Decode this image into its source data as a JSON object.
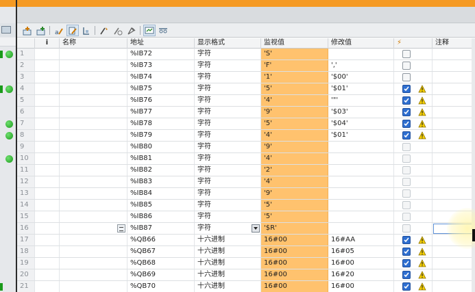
{
  "columns": {
    "num": "",
    "info": "i",
    "name": "名称",
    "address": "地址",
    "format": "显示格式",
    "monitor": "监视值",
    "modify": "修改值",
    "trigger": "⚡",
    "comment": "注释"
  },
  "rows": [
    {
      "num": "1",
      "address": "%IB72",
      "format": "字符",
      "monitor": "'S'",
      "modify": "",
      "checked": false,
      "warn": false,
      "status": "dot-mark"
    },
    {
      "num": "2",
      "address": "%IB73",
      "format": "字符",
      "monitor": "'F'",
      "modify": "','",
      "checked": false,
      "warn": false,
      "status": ""
    },
    {
      "num": "3",
      "address": "%IB74",
      "format": "字符",
      "monitor": "'1'",
      "modify": "'$00'",
      "checked": false,
      "warn": false,
      "status": ""
    },
    {
      "num": "4",
      "address": "%IB75",
      "format": "字符",
      "monitor": "'5'",
      "modify": "'$01'",
      "checked": true,
      "warn": true,
      "status": "dot-mark"
    },
    {
      "num": "5",
      "address": "%IB76",
      "format": "字符",
      "monitor": "'4'",
      "modify": "'\"'",
      "checked": true,
      "warn": true,
      "status": ""
    },
    {
      "num": "6",
      "address": "%IB77",
      "format": "字符",
      "monitor": "'9'",
      "modify": "'$03'",
      "checked": true,
      "warn": true,
      "status": ""
    },
    {
      "num": "7",
      "address": "%IB78",
      "format": "字符",
      "monitor": "'5'",
      "modify": "'$04'",
      "checked": true,
      "warn": true,
      "status": "dot"
    },
    {
      "num": "8",
      "address": "%IB79",
      "format": "字符",
      "monitor": "'4'",
      "modify": "'$01'",
      "checked": true,
      "warn": true,
      "status": "dot"
    },
    {
      "num": "9",
      "address": "%IB80",
      "format": "字符",
      "monitor": "'9'",
      "modify": "",
      "checked": false,
      "warn": false,
      "status": "",
      "disabled": true
    },
    {
      "num": "10",
      "address": "%IB81",
      "format": "字符",
      "monitor": "'4'",
      "modify": "",
      "checked": false,
      "warn": false,
      "status": "dot",
      "disabled": true
    },
    {
      "num": "11",
      "address": "%IB82",
      "format": "字符",
      "monitor": "'2'",
      "modify": "",
      "checked": false,
      "warn": false,
      "status": "",
      "disabled": true
    },
    {
      "num": "12",
      "address": "%IB83",
      "format": "字符",
      "monitor": "'4'",
      "modify": "",
      "checked": false,
      "warn": false,
      "status": "",
      "disabled": true
    },
    {
      "num": "13",
      "address": "%IB84",
      "format": "字符",
      "monitor": "'9'",
      "modify": "",
      "checked": false,
      "warn": false,
      "status": "",
      "disabled": true
    },
    {
      "num": "14",
      "address": "%IB85",
      "format": "字符",
      "monitor": "'5'",
      "modify": "",
      "checked": false,
      "warn": false,
      "status": "",
      "disabled": true
    },
    {
      "num": "15",
      "address": "%IB86",
      "format": "字符",
      "monitor": "'5'",
      "modify": "",
      "checked": false,
      "warn": false,
      "status": "",
      "disabled": true
    },
    {
      "num": "16",
      "address": "%IB87",
      "format": "字符",
      "monitor": "'$R'",
      "modify": "",
      "checked": false,
      "warn": false,
      "status": "",
      "disabled": true,
      "selected": true
    },
    {
      "num": "17",
      "address": "%QB66",
      "format": "十六进制",
      "monitor": "16#00",
      "modify": "16#AA",
      "checked": true,
      "warn": true,
      "status": ""
    },
    {
      "num": "18",
      "address": "%QB67",
      "format": "十六进制",
      "monitor": "16#00",
      "modify": "16#05",
      "checked": true,
      "warn": true,
      "status": ""
    },
    {
      "num": "19",
      "address": "%QB68",
      "format": "十六进制",
      "monitor": "16#00",
      "modify": "16#00",
      "checked": true,
      "warn": true,
      "status": ""
    },
    {
      "num": "20",
      "address": "%QB69",
      "format": "十六进制",
      "monitor": "16#00",
      "modify": "16#20",
      "checked": true,
      "warn": true,
      "status": ""
    },
    {
      "num": "21",
      "address": "%QB70",
      "format": "十六进制",
      "monitor": "16#00",
      "modify": "16#00",
      "checked": true,
      "warn": true,
      "status": "mark"
    }
  ],
  "colors": {
    "title_orange": "#f59a23",
    "monitor_orange": "#ffc26e",
    "checkbox_blue": "#2f6fd0",
    "status_green": "#1a9a1a",
    "warn_yellow": "#f5d000"
  },
  "icons": [
    "table-icon",
    "insert-row-icon",
    "add-row-icon",
    "rename-icon",
    "edit-tag-icon",
    "display-format-icon",
    "modify-now-icon",
    "modify-trigger-icon",
    "force-icon",
    "monitor-all-icon",
    "monitor-once-icon"
  ]
}
